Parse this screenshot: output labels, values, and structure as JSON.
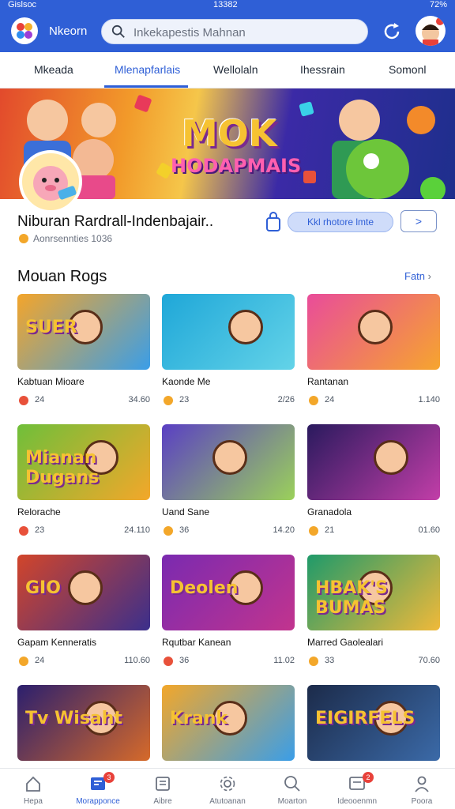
{
  "status": {
    "carrier": "Gislsoc",
    "time": "13382",
    "battery": "72%"
  },
  "header": {
    "app_name": "Nkeorn",
    "search_placeholder": "Inkekapestis Mahnan"
  },
  "tabs": [
    "Mkeada",
    "Mlenapfarlais",
    "Wellolaln",
    "Ihessrain",
    "Somonl"
  ],
  "active_tab": 1,
  "banner": {
    "title": "MOK",
    "subtitle": "HODAPMAIS"
  },
  "featured": {
    "title": "Niburan Rardrall-Indenbajair..",
    "meta": "Aonrsennties 1036",
    "cta": "Kkl rhotore lmte",
    "next": ">"
  },
  "section": {
    "title": "Mouan Rogs",
    "more": "Fatn"
  },
  "games": [
    {
      "name": "Kabtuan Mioare",
      "rating": "24",
      "stat": "34.60",
      "dot": "#e8513a",
      "thumb_text": "SUER",
      "bg": "linear-gradient(135deg,#f4a52a,#3a9ee8)"
    },
    {
      "name": "Kaonde Me",
      "rating": "23",
      "stat": "2/26",
      "dot": "#f3a72a",
      "thumb_text": "",
      "bg": "linear-gradient(135deg,#1fa7d8,#63d3e8)"
    },
    {
      "name": "Rantanan",
      "rating": "24",
      "stat": "1.140",
      "dot": "#f3a72a",
      "thumb_text": "",
      "bg": "linear-gradient(135deg,#e94c9a,#f6a52e)"
    },
    {
      "name": "Relorache",
      "rating": "23",
      "stat": "24.110",
      "dot": "#e8513a",
      "thumb_text": "Mianan Dugans",
      "bg": "linear-gradient(135deg,#6fbf3a,#f3a72a)"
    },
    {
      "name": "Uand Sane",
      "rating": "36",
      "stat": "14.20",
      "dot": "#f3a72a",
      "thumb_text": "",
      "bg": "linear-gradient(135deg,#5a3fc4,#9bd15a)"
    },
    {
      "name": "Granadola",
      "rating": "21",
      "stat": "01.60",
      "dot": "#f3a72a",
      "thumb_text": "",
      "bg": "linear-gradient(135deg,#2a1a5e,#c23ea8)"
    },
    {
      "name": "Gapam Kenneratis",
      "rating": "24",
      "stat": "110.60",
      "dot": "#f3a72a",
      "thumb_text": "GIO",
      "bg": "linear-gradient(135deg,#d2452a,#3b2f8c)"
    },
    {
      "name": "Rqutbar Kanean",
      "rating": "36",
      "stat": "11.02",
      "dot": "#e8513a",
      "thumb_text": "Deolen",
      "bg": "linear-gradient(135deg,#7a2ab0,#c2348e)"
    },
    {
      "name": "Marred Gaolealari",
      "rating": "33",
      "stat": "70.60",
      "dot": "#f3a72a",
      "thumb_text": "HBAK'S BUMAS",
      "bg": "linear-gradient(135deg,#1f9a6a,#f0b93a)"
    },
    {
      "name": "",
      "rating": "",
      "stat": "",
      "dot": "transparent",
      "thumb_text": "Tv Wisaht",
      "bg": "linear-gradient(135deg,#2b1f6e,#d66a2a)"
    },
    {
      "name": "",
      "rating": "",
      "stat": "",
      "dot": "transparent",
      "thumb_text": "Krank",
      "bg": "linear-gradient(135deg,#f3a72a,#3a9ee8)"
    },
    {
      "name": "",
      "rating": "",
      "stat": "",
      "dot": "transparent",
      "thumb_text": "EIGIRFELS",
      "bg": "linear-gradient(135deg,#1c2b4a,#3b6aa8)"
    }
  ],
  "nav": [
    {
      "label": "Hepa",
      "icon": "home-icon",
      "badge": ""
    },
    {
      "label": "Morapponce",
      "icon": "library-icon",
      "badge": "3"
    },
    {
      "label": "Aibre",
      "icon": "list-icon",
      "badge": ""
    },
    {
      "label": "Atutoanan",
      "icon": "settings-icon",
      "badge": ""
    },
    {
      "label": "Moarton",
      "icon": "search-icon",
      "badge": ""
    },
    {
      "label": "Ideooenmn",
      "icon": "messages-icon",
      "badge": "2"
    },
    {
      "label": "Poora",
      "icon": "profile-icon",
      "badge": ""
    }
  ]
}
